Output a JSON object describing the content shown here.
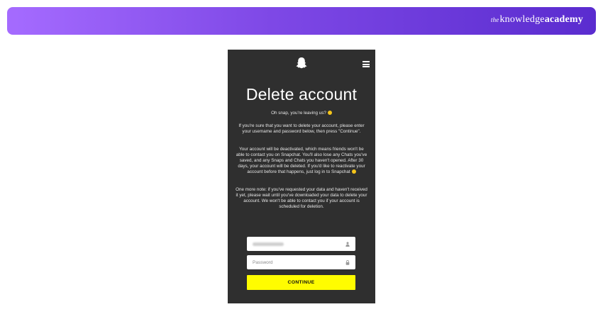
{
  "banner": {
    "brand_prefix": "the",
    "brand_knowledge": "knowledge",
    "brand_academy": "academy",
    "gradient_colors": [
      "#a56bff",
      "#5a2ccf"
    ]
  },
  "page": {
    "title": "Delete account",
    "intro": "Oh snap, you're leaving us?",
    "paragraph1": "If you're sure that you want to delete your account, please enter your username and password below, then press \"Continue\".",
    "paragraph2": "Your account will be deactivated, which means friends won't be able to contact you on Snapchat. You'll also lose any Chats you've saved, and any Snaps and Chats you haven't opened. After 30 days, your account will be deleted. If you'd like to reactivate your account before that happens, just log in to Snapchat",
    "paragraph3": "One more note: if you've requested your data and haven't received it yet, please wait until you've downloaded your data to delete your account. We won't be able to contact you if your account is scheduled for deletion."
  },
  "form": {
    "password_placeholder": "Password",
    "continue_label": "CONTINUE"
  },
  "colors": {
    "phone_bg": "#2f2f2f",
    "button": "#fffc00",
    "emoji": "#f5c51a"
  },
  "icons": {
    "logo": "snapchat-ghost-icon",
    "menu": "hamburger-menu-icon",
    "username": "user-icon",
    "password": "lock-icon"
  }
}
